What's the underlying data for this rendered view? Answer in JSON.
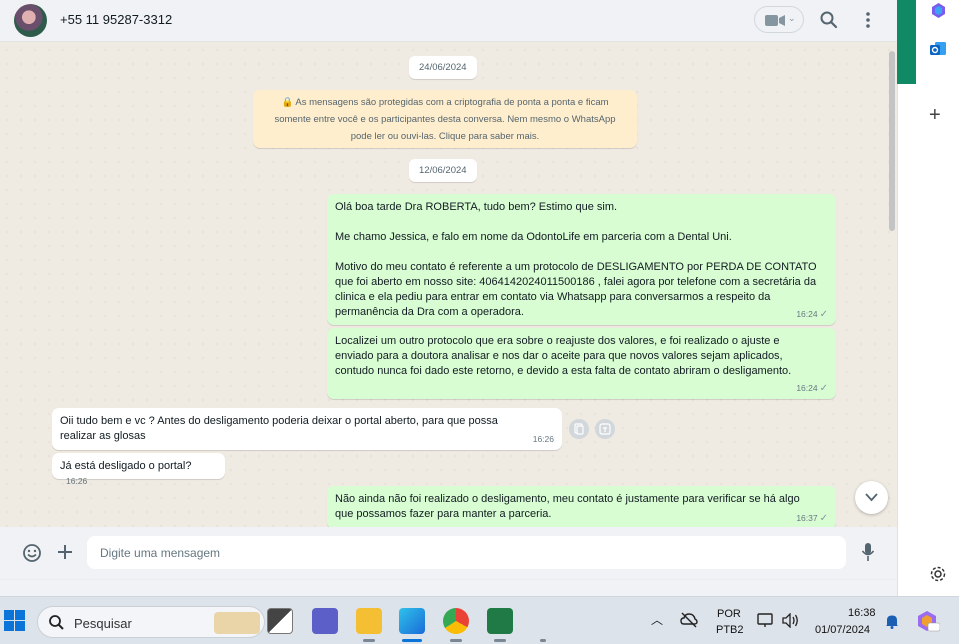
{
  "header": {
    "contact_name": "+55 11 95287-3312"
  },
  "chat": {
    "date_1": "24/06/2024",
    "encryption_notice_line_1": "🔒 As mensagens são protegidas com a criptografia de ponta a ponta e ficam",
    "encryption_notice_line_2": "somente entre você e os participantes desta conversa. Nem mesmo o WhatsApp",
    "encryption_notice_line_3": "pode ler ou ouvi-las. Clique para saber mais.",
    "date_2": "12/06/2024",
    "messages": [
      {
        "direction": "out",
        "lines": [
          "Olá boa tarde Dra ROBERTA, tudo bem? Estimo que sim.",
          "Me chamo Jessica, e falo em nome da OdontoLife em parceria com a Dental Uni.",
          "Motivo do meu contato é referente a um protocolo de DESLIGAMENTO por PERDA DE CONTATO que foi aberto em nosso site: 4064142024011500186 , falei agora por telefone com a secretária da clinica e ela pediu para entrar em contato via Whatsapp para conversarmos a respeito da permanência da Dra  com a operadora."
        ],
        "time": "16:24"
      },
      {
        "direction": "out",
        "lines": [
          "Localizei um outro protocolo que era sobre o reajuste dos valores, e foi realizado o ajuste e enviado para a doutora analisar e nos dar o aceite para que novos valores sejam aplicados, contudo nunca foi dado este retorno, e devido a esta falta de contato abriram o desligamento."
        ],
        "time": "16:24"
      },
      {
        "direction": "in",
        "lines": [
          "Oii tudo bem e vc ? Antes do desligamento poderia deixar o portal aberto, para que possa realizar as glosas"
        ],
        "time": "16:26"
      },
      {
        "direction": "in",
        "lines": [
          "Já está desligado o portal?"
        ],
        "time": "16:26"
      },
      {
        "direction": "out",
        "lines": [
          "Não ainda não foi realizado o desligamento, meu contato é justamente para verificar se há algo que possamos fazer para manter a parceria."
        ],
        "time": "16:37"
      }
    ]
  },
  "composer": {
    "placeholder": "Digite uma mensagem"
  },
  "taskbar": {
    "search_label": "Pesquisar",
    "lang_1": "POR",
    "lang_2": "PTB2",
    "time": "16:38",
    "date": "01/07/2024"
  },
  "icons": {
    "search": "search-icon",
    "menu": "kebab-menu-icon",
    "video": "video-call-icon",
    "emoji": "emoji-icon",
    "attach": "plus-icon",
    "mic": "microphone-icon"
  },
  "colors": {
    "outgoing_bubble": "#d9fdd3",
    "incoming_bubble": "#ffffff",
    "chat_bg": "#efeae2",
    "encryption_notice_bg": "#ffeecd",
    "whatsapp_green": "#0f8a64"
  }
}
